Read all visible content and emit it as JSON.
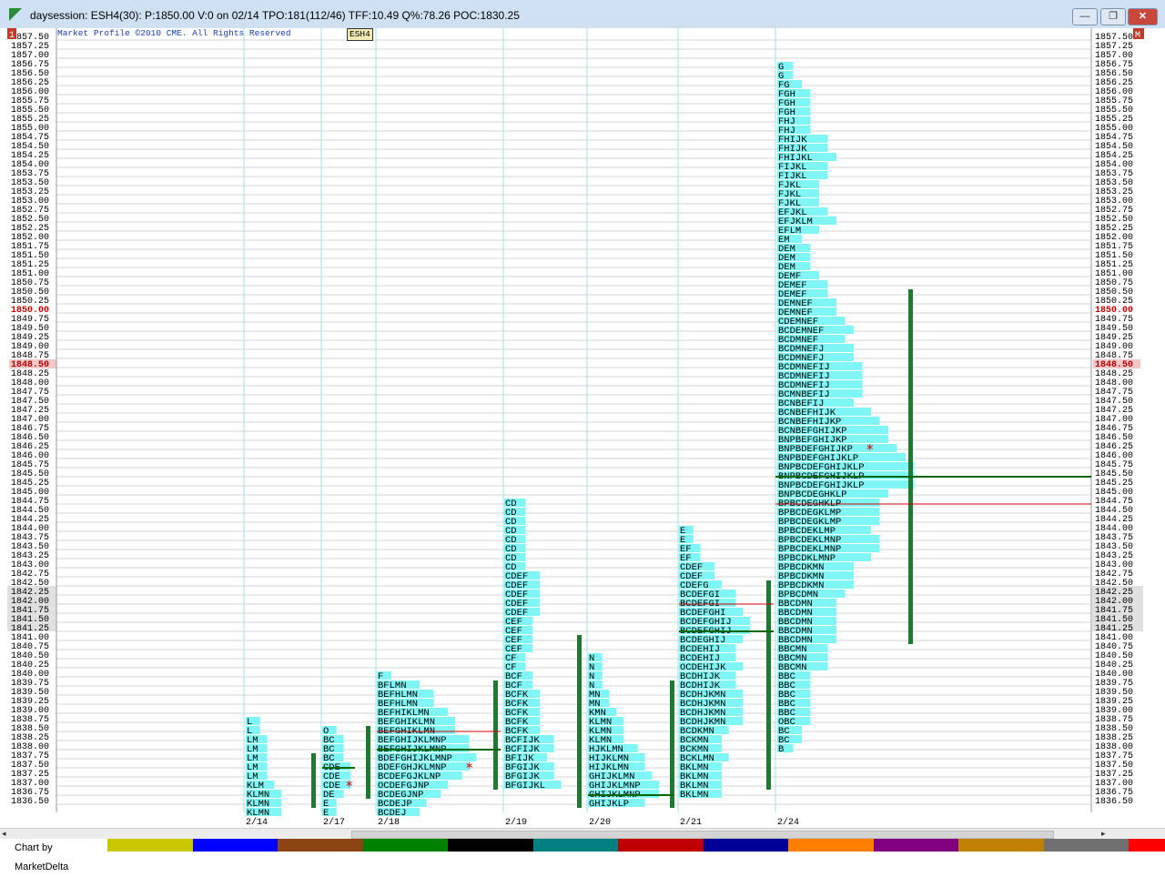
{
  "window": {
    "title": "daysession: ESH4(30): P:1850.00 V:0 on 02/14 TPO:181(112/46) TFF:10.49 Q%:78.26 POC:1830.25",
    "minimize_symbol": "—",
    "maximize_symbol": "❐",
    "close_symbol": "✕"
  },
  "chart_header": {
    "copyright": "Market Profile ©2010 CME. All Rights Reserved",
    "symbol": "ESH4",
    "left_marker": "1",
    "right_marker": "M"
  },
  "footer": {
    "credit": "Chart by MarketDelta",
    "scroll_left": "◂",
    "scroll_right": "▸",
    "swatch_colors": [
      "#c8c800",
      "#0000ff",
      "#8b4513",
      "#008000",
      "#000000",
      "#008080",
      "#c00000",
      "#000099",
      "#ff8000",
      "#800080",
      "#c08000",
      "#707070",
      "#ff0000"
    ]
  },
  "colors": {
    "profile_fill": "#7ff5f5",
    "value_area_bar": "#1e7a30",
    "current_price": "#cc0000",
    "poc_line": "#006600",
    "grid": "#d6d6d6",
    "session_line": "#9ae6e6"
  },
  "chart_data": {
    "type": "market_profile",
    "price_axis": {
      "min": 1836.5,
      "max": 1857.5,
      "tick_step": 0.25,
      "current_price": "1850.00",
      "marked_price": "1848.50"
    },
    "sessions": [
      {
        "date": "2/14",
        "letters": [
          "L",
          "L",
          "LM",
          "LM",
          "LM",
          "LM",
          "LM",
          "KLM",
          "KLMN",
          "KLMN",
          "KLMN"
        ],
        "top_price": 1838.75
      },
      {
        "date": "2/17",
        "letters": [
          "O",
          "BC",
          "BC",
          "BC",
          "CDE",
          "CDE",
          "CDE",
          "DE",
          "E",
          "E"
        ],
        "top_price": 1838.5
      },
      {
        "date": "2/18",
        "letters": [
          "F",
          "BFLMN",
          "BEFHLMN",
          "BEFHLMN",
          "BEFHIKLMN",
          "BEFGHIKLMN",
          "BEFGHIKLMN",
          "BEFGHIJKLMNP",
          "BEFGHIJKLMNP",
          "BDEFGHIJKLMNP",
          "BDEFGHJKLMNP",
          "BCDEFGJKLNP",
          "OCDEFGJNP",
          "BCDEGJNP",
          "BCDEJP",
          "BCDEJ"
        ],
        "top_price": 1840.0
      },
      {
        "date": "2/19",
        "letters": [
          "CD",
          "CD",
          "CD",
          "CD",
          "CD",
          "CD",
          "CD",
          "CD",
          "CDEF",
          "CDEF",
          "CDEF",
          "CDEF",
          "CDEF",
          "CEF",
          "CEF",
          "CEF",
          "CEF",
          "CF",
          "CF",
          "BCF",
          "BCF",
          "BCFK",
          "BCFK",
          "BCFK",
          "BCFK",
          "BCFK",
          "BCFIJK",
          "BCFIJK",
          "BFIJK",
          "BFGIJK",
          "BFGIJK",
          "BFGIJKL"
        ],
        "top_price": 1844.75
      },
      {
        "date": "2/20",
        "letters": [
          "N",
          "N",
          "N",
          "N",
          "MN",
          "MN",
          "KMN",
          "KLMN",
          "KLMN",
          "KLMN",
          "HJKLMN",
          "HIJKLMN",
          "HIJKLMN",
          "GHIJKLMN",
          "GHIJKLMNP",
          "GHIJKLMNP",
          "GHIJKLP"
        ],
        "top_price": 1840.5
      },
      {
        "date": "2/21",
        "letters": [
          "E",
          "E",
          "EF",
          "EF",
          "CDEF",
          "CDEF",
          "CDEFG",
          "BCDEFGI",
          "BCDEFGI",
          "BCDEFGHI",
          "BCDEFGHIJ",
          "BCDEFGHIJ",
          "BCDEGHIJ",
          "BCDEHIJ",
          "BCDEHIJ",
          "OCDEHIJK",
          "BCDHIJK",
          "BCDHIJK",
          "BCDHJKMN",
          "BCDHJKMN",
          "BCDHJKMN",
          "BCDHJKMN",
          "BCDKMN",
          "BCKMN",
          "BCKMN",
          "BCKLMN",
          "BKLMN",
          "BKLMN",
          "BKLMN",
          "BKLMN"
        ],
        "top_price": 1844.0
      },
      {
        "date": "2/24",
        "letters": [
          "G",
          "G",
          "FG",
          "FGH",
          "FGH",
          "FGH",
          "FHJ",
          "FHJ",
          "FHIJK",
          "FHIJK",
          "FHIJKL",
          "FIJKL",
          "FIJKL",
          "FJKL",
          "FJKL",
          "FJKL",
          "EFJKL",
          "EFJKLM",
          "EFLM",
          "EM",
          "DEM",
          "DEM",
          "DEM",
          "DEMF",
          "DEMEF",
          "DEMEF",
          "DEMNEF",
          "DEMNEF",
          "CDEMNEF",
          "BCDEMNEF",
          "BCDMNEF",
          "BCDMNEFJ",
          "BCDMNEFJ",
          "BCDMNEFIJ",
          "BCDMNEFIJ",
          "BCDMNEFIJ",
          "BCMNBEFIJ",
          "BCNBEFIJ",
          "BCNBEFHIJK",
          "BCNBEFHIJKP",
          "BCNBEFGHIJKP",
          "BNPBEFGHIJKP",
          "BNPBDEFGHIJKP",
          "BNPBDEFGHIJKLP",
          "BNPBCDEFGHIJKLP",
          "BNPBCDEFGHIJKLP",
          "BNPBCDEFGHIJKLP",
          "BNPBCDEGHKLP",
          "BPBCDEGHKLP",
          "BPBCDEGKLMP",
          "BPBCDEGKLMP",
          "BPBCDEKLMP",
          "BPBCDEKLMNP",
          "BPBCDEKLMNP",
          "BPBCDKLMNP",
          "BPBCDKMN",
          "BPBCDKMN",
          "BPBCDKMN",
          "BPBCDMN",
          "BBCDMN",
          "BBCDMN",
          "BBCDMN",
          "BBCDMN",
          "BBCDMN",
          "BBCMN",
          "BBCMN",
          "BBCMN",
          "BBC",
          "BBC",
          "BBC",
          "BBC",
          "BBC",
          "OBC",
          "BC",
          "BC",
          "B"
        ],
        "top_price": 1856.75
      }
    ]
  }
}
